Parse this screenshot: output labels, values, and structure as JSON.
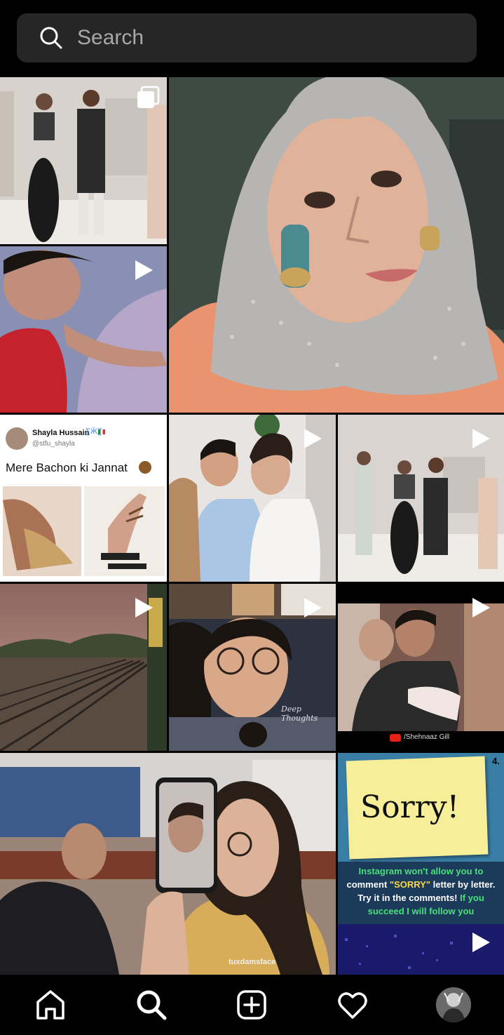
{
  "search": {
    "placeholder": "Search"
  },
  "grid": {
    "tweet": {
      "name": "Shayla Hussain",
      "handle": "@stfu_shayla",
      "text": "Mere Bachon ki Jannat"
    },
    "watermarks": {
      "deep_thoughts": "Deep Thoughts",
      "shehnaaz": "/Shehnaaz Gill",
      "tuxdamsface": "tuxdamsface"
    },
    "sorry_post": {
      "number": "4.",
      "sign": "Sorry!",
      "line1": "Instagram won't allow you to",
      "line2_a": "comment ",
      "line2_b": "\"SORRY\"",
      "line2_c": " letter by letter.",
      "line3_a": "Try it in the comments! ",
      "line3_b": "If you",
      "line4": "succeed I will follow you"
    }
  },
  "nav": {
    "items": [
      "home",
      "search",
      "new-post",
      "activity",
      "profile"
    ]
  },
  "colors": {
    "search_bg": "#262626",
    "placeholder": "#a8a8a8",
    "sorry_green": "#48e07a",
    "sorry_yellow": "#f7d84a"
  }
}
